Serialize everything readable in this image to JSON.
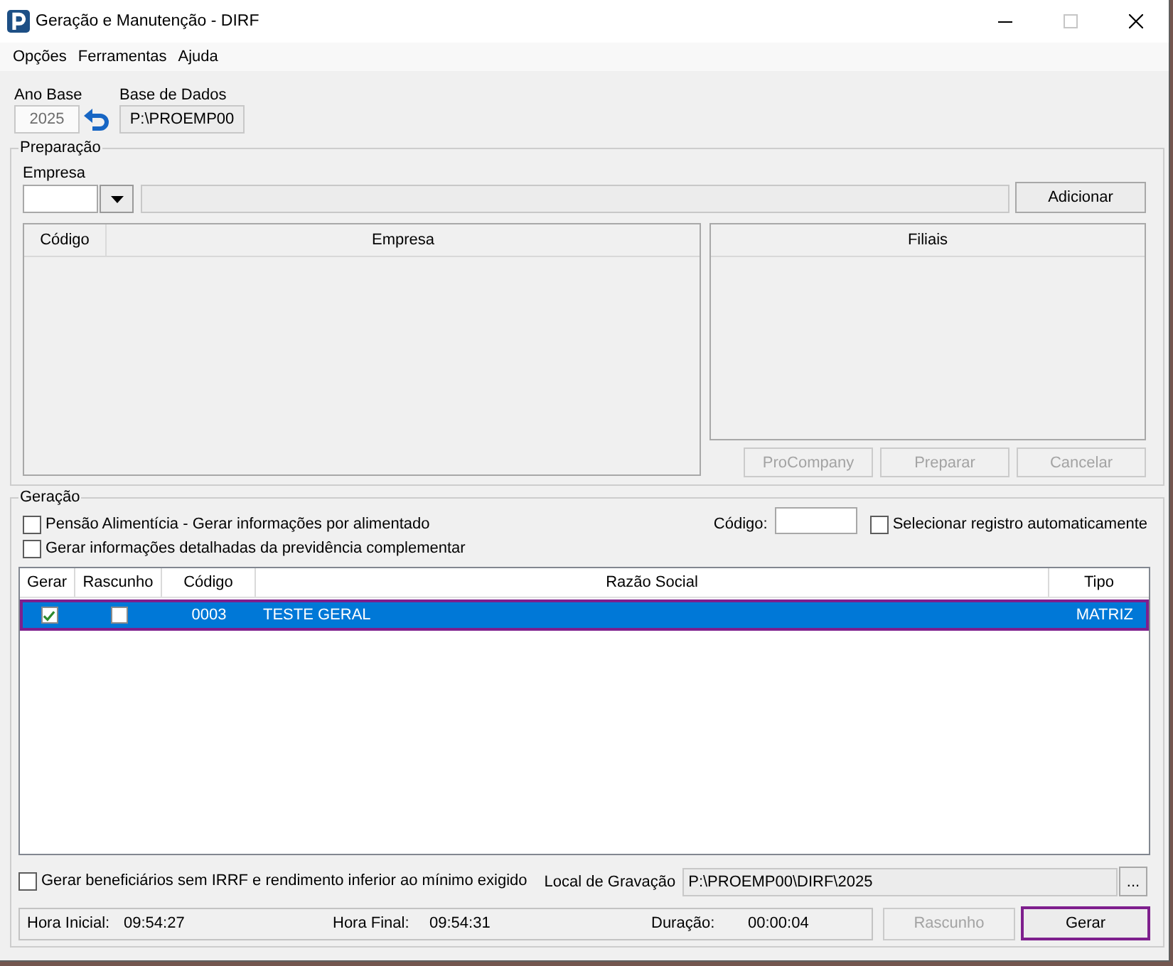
{
  "window": {
    "title": "Geração e Manutenção - DIRF",
    "maximize_disabled": true
  },
  "menu": [
    {
      "label": "Opções"
    },
    {
      "label": "Ferramentas"
    },
    {
      "label": "Ajuda"
    }
  ],
  "ano_base": {
    "label": "Ano Base",
    "value": "2025",
    "disabled": true
  },
  "base_de_dados": {
    "label": "Base de Dados",
    "value": "P:\\PROEMP00",
    "read_only": true
  },
  "preparacao": {
    "title": "Preparação",
    "empresa": {
      "label": "Empresa",
      "code_field": {
        "read_only": false
      },
      "name_field": {
        "read_only": true
      }
    },
    "add_button": {
      "label": "Adicionar",
      "disabled": false
    },
    "empresas_list": {
      "columns": [
        "Código",
        "Empresa"
      ],
      "disabled": true
    },
    "filiais_list": {
      "columns": [
        "Filiais"
      ],
      "disabled": true
    },
    "buttons": [
      {
        "label": "ProCompany",
        "disabled": true
      },
      {
        "label": "Preparar",
        "disabled": true
      },
      {
        "label": "Cancelar",
        "disabled": true
      }
    ]
  },
  "geracao": {
    "title": "Geração",
    "options": [
      {
        "label": "Pensão Alimentícia - Gerar informações por alimentado",
        "checked": false
      },
      {
        "label": "Gerar informações detalhadas da previdência complementar",
        "checked": false
      }
    ],
    "codigo": {
      "label": "Código:"
    },
    "auto_select": {
      "label": "Selecionar registro automaticamente",
      "checked": false
    },
    "table": {
      "columns": [
        "Gerar",
        "Rascunho",
        "Código",
        "Razão Social",
        "Tipo"
      ],
      "rows": [
        {
          "selected": true,
          "highlighted": true,
          "gerar": true,
          "rascunho": false,
          "codigo": "0003",
          "razao_social": "TESTE GERAL",
          "tipo": "MATRIZ"
        }
      ]
    },
    "beneficiarios": {
      "label": "Gerar beneficiários sem IRRF e rendimento inferior ao mínimo exigido",
      "checked": false
    },
    "local_gravacao": {
      "label": "Local de Gravação",
      "value": "P:\\PROEMP00\\DIRF\\2025",
      "read_only": true,
      "browse_label": "..."
    },
    "status": [
      {
        "label": "Hora Inicial:",
        "value": "09:54:27"
      },
      {
        "label": "Hora Final:",
        "value": "09:54:31"
      },
      {
        "label": "Duração:",
        "value": "00:00:04"
      }
    ],
    "buttons": [
      {
        "label": "Rascunho",
        "disabled": true,
        "highlighted": false
      },
      {
        "label": "Gerar",
        "disabled": false,
        "highlighted": true
      }
    ]
  }
}
